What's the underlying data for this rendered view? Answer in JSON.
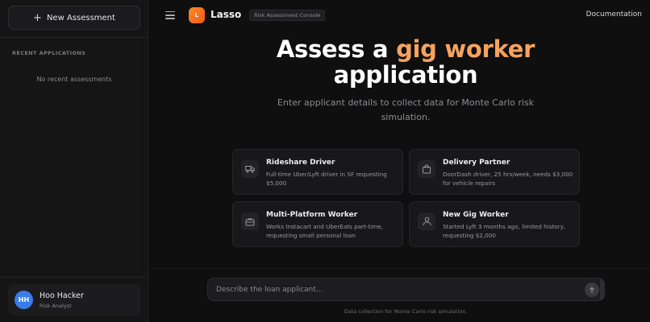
{
  "sidebar": {
    "new_button_label": "New Assessment",
    "recent_heading": "RECENT APPLICATIONS",
    "empty_text": "No recent assessments",
    "user": {
      "initials": "HH",
      "name": "Hoo Hacker",
      "role": "Risk Analyst"
    }
  },
  "header": {
    "logo_letter": "L",
    "brand": "Lasso",
    "badge": "Risk Assessment Console",
    "docs_link": "Documentation"
  },
  "hero": {
    "title_pre": "Assess a ",
    "title_accent": "gig worker",
    "title_line2": "application",
    "subtitle": "Enter applicant details to collect data for Monte Carlo risk simulation."
  },
  "cards": [
    {
      "title": "Rideshare Driver",
      "desc": "Full-time Uber/Lyft driver in SF requesting $5,000",
      "icon": "truck-icon"
    },
    {
      "title": "Delivery Partner",
      "desc": "DoorDash driver, 25 hrs/week, needs $3,000 for vehicle repairs",
      "icon": "bag-icon"
    },
    {
      "title": "Multi-Platform Worker",
      "desc": "Works Instacart and UberEats part-time, requesting small personal loan",
      "icon": "briefcase-icon"
    },
    {
      "title": "New Gig Worker",
      "desc": "Started Lyft 3 months ago, limited history, requesting $2,000",
      "icon": "user-icon"
    }
  ],
  "composer": {
    "placeholder": "Describe the loan applicant...",
    "footer": "Data collection for Monte Carlo risk simulation."
  },
  "colors": {
    "accent": "#f7a360",
    "logo": "#f26a1b",
    "avatar": "#3b7be8"
  }
}
